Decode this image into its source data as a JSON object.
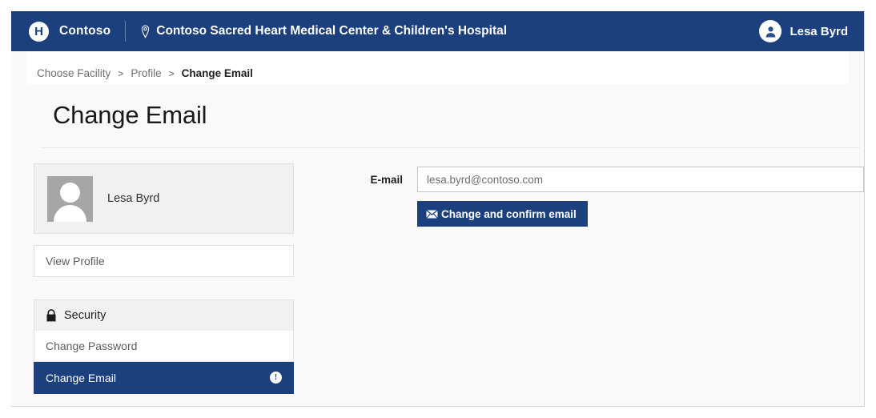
{
  "header": {
    "logo_icon": "hospital-h-logo-icon",
    "brand": "Contoso",
    "location_icon": "location-pin-icon",
    "facility": "Contoso Sacred Heart Medical Center & Children's Hospital",
    "user_avatar_icon": "person-avatar-icon",
    "user_name": "Lesa Byrd",
    "background_color": "#1c3f7e"
  },
  "breadcrumb": {
    "items": [
      {
        "label": "Choose Facility",
        "current": false
      },
      {
        "label": "Profile",
        "current": false
      },
      {
        "label": "Change Email",
        "current": true
      }
    ],
    "separator": ">"
  },
  "page": {
    "title": "Change Email"
  },
  "sidebar": {
    "profile_card": {
      "avatar_icon": "placeholder-person-avatar-icon",
      "name": "Lesa Byrd"
    },
    "view_profile_label": "View Profile",
    "security_group": {
      "icon": "lock-icon",
      "label": "Security",
      "items": [
        {
          "label": "Change Password",
          "active": false,
          "badge_icon": ""
        },
        {
          "label": "Change Email",
          "active": true,
          "badge_icon": "info-icon",
          "badge_glyph": "!"
        }
      ]
    }
  },
  "form": {
    "email_label": "E-mail",
    "email_value": "",
    "email_placeholder": "lesa.byrd@contoso.com",
    "submit_icon": "envelope-icon",
    "submit_label": "Change and confirm email",
    "submit_color": "#1c3f7e"
  }
}
